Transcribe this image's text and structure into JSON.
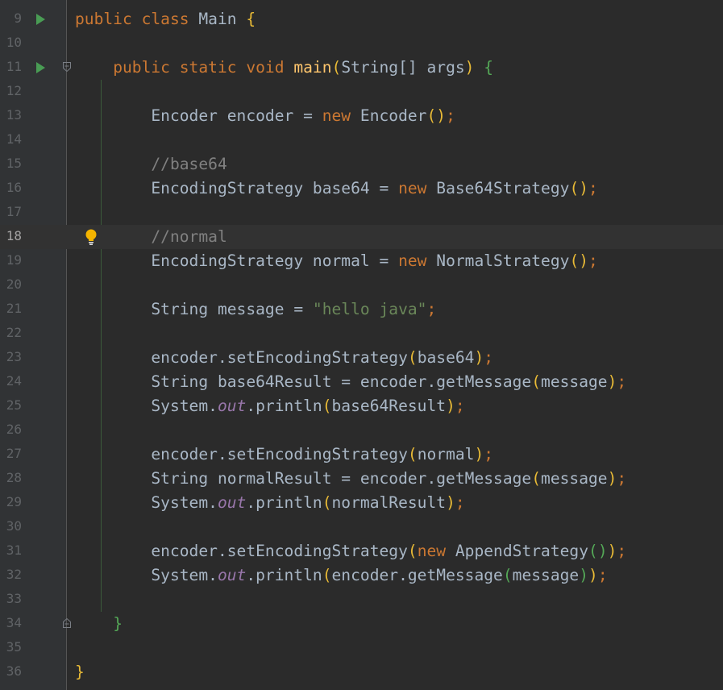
{
  "lines": [
    {
      "number": "9",
      "tokens": [
        [
          "kw",
          "public "
        ],
        [
          "kw",
          "class "
        ],
        [
          "cls",
          "Main "
        ],
        [
          "p",
          "{"
        ]
      ]
    },
    {
      "number": "10",
      "tokens": []
    },
    {
      "number": "11",
      "tokens": [
        [
          "t",
          "    "
        ],
        [
          "kw",
          "public "
        ],
        [
          "kw",
          "static "
        ],
        [
          "kw",
          "void "
        ],
        [
          "fn",
          "main"
        ],
        [
          "p",
          "("
        ],
        [
          "t",
          "String[] args"
        ],
        [
          "p",
          ") "
        ],
        [
          "p2",
          "{"
        ]
      ]
    },
    {
      "number": "12",
      "tokens": []
    },
    {
      "number": "13",
      "tokens": [
        [
          "t",
          "        Encoder encoder = "
        ],
        [
          "kw",
          "new "
        ],
        [
          "t",
          "Encoder"
        ],
        [
          "p",
          "()"
        ],
        [
          "kw",
          ";"
        ]
      ]
    },
    {
      "number": "14",
      "tokens": []
    },
    {
      "number": "15",
      "tokens": [
        [
          "t",
          "        "
        ],
        [
          "cm",
          "//base64"
        ]
      ]
    },
    {
      "number": "16",
      "tokens": [
        [
          "t",
          "        EncodingStrategy base64 = "
        ],
        [
          "kw",
          "new "
        ],
        [
          "t",
          "Base64Strategy"
        ],
        [
          "p",
          "()"
        ],
        [
          "kw",
          ";"
        ]
      ]
    },
    {
      "number": "17",
      "tokens": []
    },
    {
      "number": "18",
      "tokens": [
        [
          "t",
          "        "
        ],
        [
          "cm",
          "//normal"
        ]
      ]
    },
    {
      "number": "19",
      "tokens": [
        [
          "t",
          "        EncodingStrategy normal = "
        ],
        [
          "kw",
          "new "
        ],
        [
          "t",
          "NormalStrategy"
        ],
        [
          "p",
          "()"
        ],
        [
          "kw",
          ";"
        ]
      ]
    },
    {
      "number": "20",
      "tokens": []
    },
    {
      "number": "21",
      "tokens": [
        [
          "t",
          "        String message = "
        ],
        [
          "str",
          "\"hello java\""
        ],
        [
          "kw",
          ";"
        ]
      ]
    },
    {
      "number": "22",
      "tokens": []
    },
    {
      "number": "23",
      "tokens": [
        [
          "t",
          "        encoder.setEncodingStrategy"
        ],
        [
          "p",
          "("
        ],
        [
          "t",
          "base64"
        ],
        [
          "p",
          ")"
        ],
        [
          "kw",
          ";"
        ]
      ]
    },
    {
      "number": "24",
      "tokens": [
        [
          "t",
          "        String base64Result = encoder.getMessage"
        ],
        [
          "p",
          "("
        ],
        [
          "t",
          "message"
        ],
        [
          "p",
          ")"
        ],
        [
          "kw",
          ";"
        ]
      ]
    },
    {
      "number": "25",
      "tokens": [
        [
          "t",
          "        System."
        ],
        [
          "st",
          "out"
        ],
        [
          "t",
          ".println"
        ],
        [
          "p",
          "("
        ],
        [
          "t",
          "base64Result"
        ],
        [
          "p",
          ")"
        ],
        [
          "kw",
          ";"
        ]
      ]
    },
    {
      "number": "26",
      "tokens": []
    },
    {
      "number": "27",
      "tokens": [
        [
          "t",
          "        encoder.setEncodingStrategy"
        ],
        [
          "p",
          "("
        ],
        [
          "t",
          "normal"
        ],
        [
          "p",
          ")"
        ],
        [
          "kw",
          ";"
        ]
      ]
    },
    {
      "number": "28",
      "tokens": [
        [
          "t",
          "        String normalResult = encoder.getMessage"
        ],
        [
          "p",
          "("
        ],
        [
          "t",
          "message"
        ],
        [
          "p",
          ")"
        ],
        [
          "kw",
          ";"
        ]
      ]
    },
    {
      "number": "29",
      "tokens": [
        [
          "t",
          "        System."
        ],
        [
          "st",
          "out"
        ],
        [
          "t",
          ".println"
        ],
        [
          "p",
          "("
        ],
        [
          "t",
          "normalResult"
        ],
        [
          "p",
          ")"
        ],
        [
          "kw",
          ";"
        ]
      ]
    },
    {
      "number": "30",
      "tokens": []
    },
    {
      "number": "31",
      "tokens": [
        [
          "t",
          "        encoder.setEncodingStrategy"
        ],
        [
          "p",
          "("
        ],
        [
          "kw",
          "new "
        ],
        [
          "t",
          "AppendStrategy"
        ],
        [
          "p2",
          "()"
        ],
        [
          "p",
          ")"
        ],
        [
          "kw",
          ";"
        ]
      ]
    },
    {
      "number": "32",
      "tokens": [
        [
          "t",
          "        System."
        ],
        [
          "st",
          "out"
        ],
        [
          "t",
          ".println"
        ],
        [
          "p",
          "("
        ],
        [
          "t",
          "encoder.getMessage"
        ],
        [
          "p2",
          "("
        ],
        [
          "t",
          "message"
        ],
        [
          "p2",
          ")"
        ],
        [
          "p",
          ")"
        ],
        [
          "kw",
          ";"
        ]
      ]
    },
    {
      "number": "33",
      "tokens": []
    },
    {
      "number": "34",
      "tokens": [
        [
          "t",
          "    "
        ],
        [
          "p2",
          "}"
        ]
      ]
    },
    {
      "number": "35",
      "tokens": []
    },
    {
      "number": "36",
      "tokens": [
        [
          "p",
          "}"
        ]
      ]
    }
  ],
  "current_line": "18",
  "gutter_icons": {
    "run_lines": [
      "9",
      "11"
    ],
    "fold_lines": [
      "11",
      "34"
    ],
    "intention_line": "18"
  }
}
